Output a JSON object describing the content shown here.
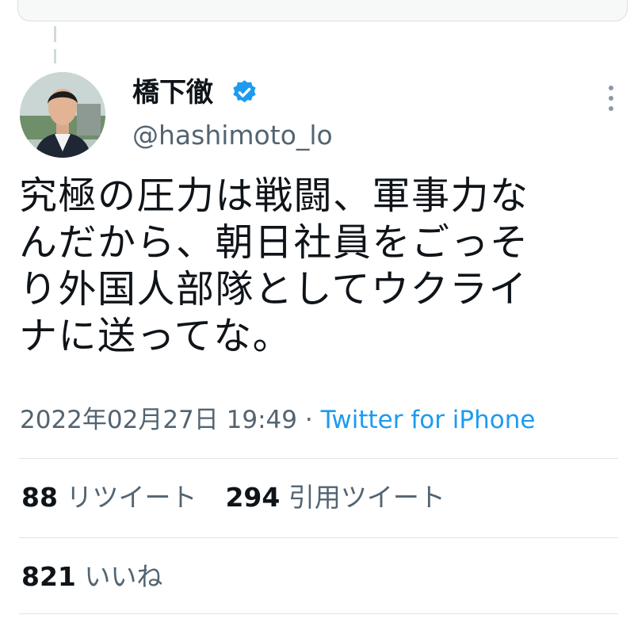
{
  "author": {
    "display_name": "橋下徹",
    "handle": "@hashimoto_lo",
    "verified": true
  },
  "tweet": {
    "lines": [
      "究極の圧力は戦闘、軍事力な",
      "んだから、朝日社員をごっそ",
      "り外国人部隊としてウクライ",
      "ナに送ってな。"
    ],
    "timestamp": "2022年02月27日 19:49",
    "separator": "·",
    "source": "Twitter for iPhone"
  },
  "stats": {
    "retweets_count": "88",
    "retweets_label": "リツイート",
    "quotes_count": "294",
    "quotes_label": "引用ツイート",
    "likes_count": "821",
    "likes_label": "いいね"
  },
  "colors": {
    "verified": "#1d9bf0",
    "link": "#1d9bf0",
    "secondary_text": "#536471"
  },
  "icons": [
    "verified-badge-icon",
    "more-options-icon"
  ]
}
